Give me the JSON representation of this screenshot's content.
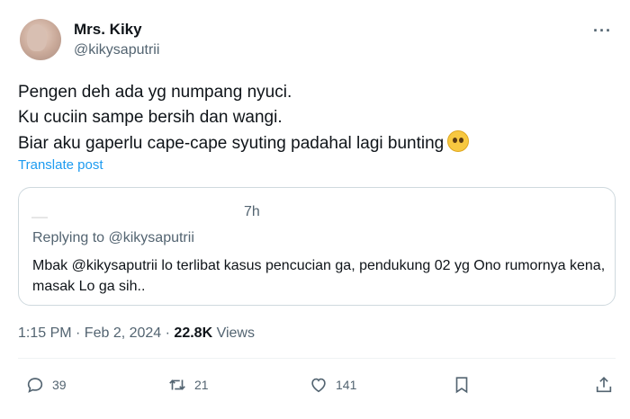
{
  "author": {
    "name": "Mrs. Kiky",
    "handle": "@kikysaputrii"
  },
  "more_label": "···",
  "tweet": {
    "lines": [
      "Pengen deh ada yg numpang nyuci.",
      "Ku cuciin sampe bersih dan wangi.",
      "Biar aku gaperlu cape-cape syuting padahal lagi bunting"
    ],
    "translate_label": "Translate post"
  },
  "quote": {
    "time": "7h",
    "replying_to": "Replying to @kikysaputrii",
    "text": "Mbak @kikysaputrii lo terlibat kasus pencucian ga, pendukung 02 yg Ono rumornya kena, masak Lo ga sih.."
  },
  "meta": {
    "datetime": "1:15 PM · Feb 2, 2024 · ",
    "views_count": "22.8K",
    "views_label": " Views"
  },
  "actions": {
    "replies": "39",
    "reposts": "21",
    "likes": "141"
  }
}
